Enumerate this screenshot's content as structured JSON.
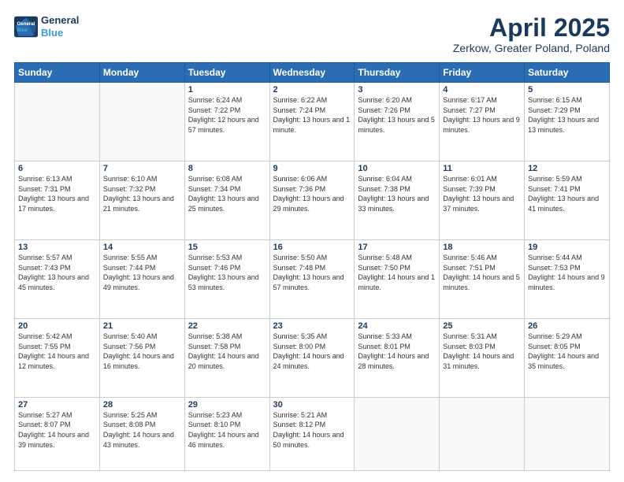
{
  "header": {
    "logo_line1": "General",
    "logo_line2": "Blue",
    "month": "April 2025",
    "location": "Zerkow, Greater Poland, Poland"
  },
  "weekdays": [
    "Sunday",
    "Monday",
    "Tuesday",
    "Wednesday",
    "Thursday",
    "Friday",
    "Saturday"
  ],
  "weeks": [
    [
      {
        "day": "",
        "info": ""
      },
      {
        "day": "",
        "info": ""
      },
      {
        "day": "1",
        "info": "Sunrise: 6:24 AM\nSunset: 7:22 PM\nDaylight: 12 hours and 57 minutes."
      },
      {
        "day": "2",
        "info": "Sunrise: 6:22 AM\nSunset: 7:24 PM\nDaylight: 13 hours and 1 minute."
      },
      {
        "day": "3",
        "info": "Sunrise: 6:20 AM\nSunset: 7:26 PM\nDaylight: 13 hours and 5 minutes."
      },
      {
        "day": "4",
        "info": "Sunrise: 6:17 AM\nSunset: 7:27 PM\nDaylight: 13 hours and 9 minutes."
      },
      {
        "day": "5",
        "info": "Sunrise: 6:15 AM\nSunset: 7:29 PM\nDaylight: 13 hours and 13 minutes."
      }
    ],
    [
      {
        "day": "6",
        "info": "Sunrise: 6:13 AM\nSunset: 7:31 PM\nDaylight: 13 hours and 17 minutes."
      },
      {
        "day": "7",
        "info": "Sunrise: 6:10 AM\nSunset: 7:32 PM\nDaylight: 13 hours and 21 minutes."
      },
      {
        "day": "8",
        "info": "Sunrise: 6:08 AM\nSunset: 7:34 PM\nDaylight: 13 hours and 25 minutes."
      },
      {
        "day": "9",
        "info": "Sunrise: 6:06 AM\nSunset: 7:36 PM\nDaylight: 13 hours and 29 minutes."
      },
      {
        "day": "10",
        "info": "Sunrise: 6:04 AM\nSunset: 7:38 PM\nDaylight: 13 hours and 33 minutes."
      },
      {
        "day": "11",
        "info": "Sunrise: 6:01 AM\nSunset: 7:39 PM\nDaylight: 13 hours and 37 minutes."
      },
      {
        "day": "12",
        "info": "Sunrise: 5:59 AM\nSunset: 7:41 PM\nDaylight: 13 hours and 41 minutes."
      }
    ],
    [
      {
        "day": "13",
        "info": "Sunrise: 5:57 AM\nSunset: 7:43 PM\nDaylight: 13 hours and 45 minutes."
      },
      {
        "day": "14",
        "info": "Sunrise: 5:55 AM\nSunset: 7:44 PM\nDaylight: 13 hours and 49 minutes."
      },
      {
        "day": "15",
        "info": "Sunrise: 5:53 AM\nSunset: 7:46 PM\nDaylight: 13 hours and 53 minutes."
      },
      {
        "day": "16",
        "info": "Sunrise: 5:50 AM\nSunset: 7:48 PM\nDaylight: 13 hours and 57 minutes."
      },
      {
        "day": "17",
        "info": "Sunrise: 5:48 AM\nSunset: 7:50 PM\nDaylight: 14 hours and 1 minute."
      },
      {
        "day": "18",
        "info": "Sunrise: 5:46 AM\nSunset: 7:51 PM\nDaylight: 14 hours and 5 minutes."
      },
      {
        "day": "19",
        "info": "Sunrise: 5:44 AM\nSunset: 7:53 PM\nDaylight: 14 hours and 9 minutes."
      }
    ],
    [
      {
        "day": "20",
        "info": "Sunrise: 5:42 AM\nSunset: 7:55 PM\nDaylight: 14 hours and 12 minutes."
      },
      {
        "day": "21",
        "info": "Sunrise: 5:40 AM\nSunset: 7:56 PM\nDaylight: 14 hours and 16 minutes."
      },
      {
        "day": "22",
        "info": "Sunrise: 5:38 AM\nSunset: 7:58 PM\nDaylight: 14 hours and 20 minutes."
      },
      {
        "day": "23",
        "info": "Sunrise: 5:35 AM\nSunset: 8:00 PM\nDaylight: 14 hours and 24 minutes."
      },
      {
        "day": "24",
        "info": "Sunrise: 5:33 AM\nSunset: 8:01 PM\nDaylight: 14 hours and 28 minutes."
      },
      {
        "day": "25",
        "info": "Sunrise: 5:31 AM\nSunset: 8:03 PM\nDaylight: 14 hours and 31 minutes."
      },
      {
        "day": "26",
        "info": "Sunrise: 5:29 AM\nSunset: 8:05 PM\nDaylight: 14 hours and 35 minutes."
      }
    ],
    [
      {
        "day": "27",
        "info": "Sunrise: 5:27 AM\nSunset: 8:07 PM\nDaylight: 14 hours and 39 minutes."
      },
      {
        "day": "28",
        "info": "Sunrise: 5:25 AM\nSunset: 8:08 PM\nDaylight: 14 hours and 43 minutes."
      },
      {
        "day": "29",
        "info": "Sunrise: 5:23 AM\nSunset: 8:10 PM\nDaylight: 14 hours and 46 minutes."
      },
      {
        "day": "30",
        "info": "Sunrise: 5:21 AM\nSunset: 8:12 PM\nDaylight: 14 hours and 50 minutes."
      },
      {
        "day": "",
        "info": ""
      },
      {
        "day": "",
        "info": ""
      },
      {
        "day": "",
        "info": ""
      }
    ]
  ]
}
